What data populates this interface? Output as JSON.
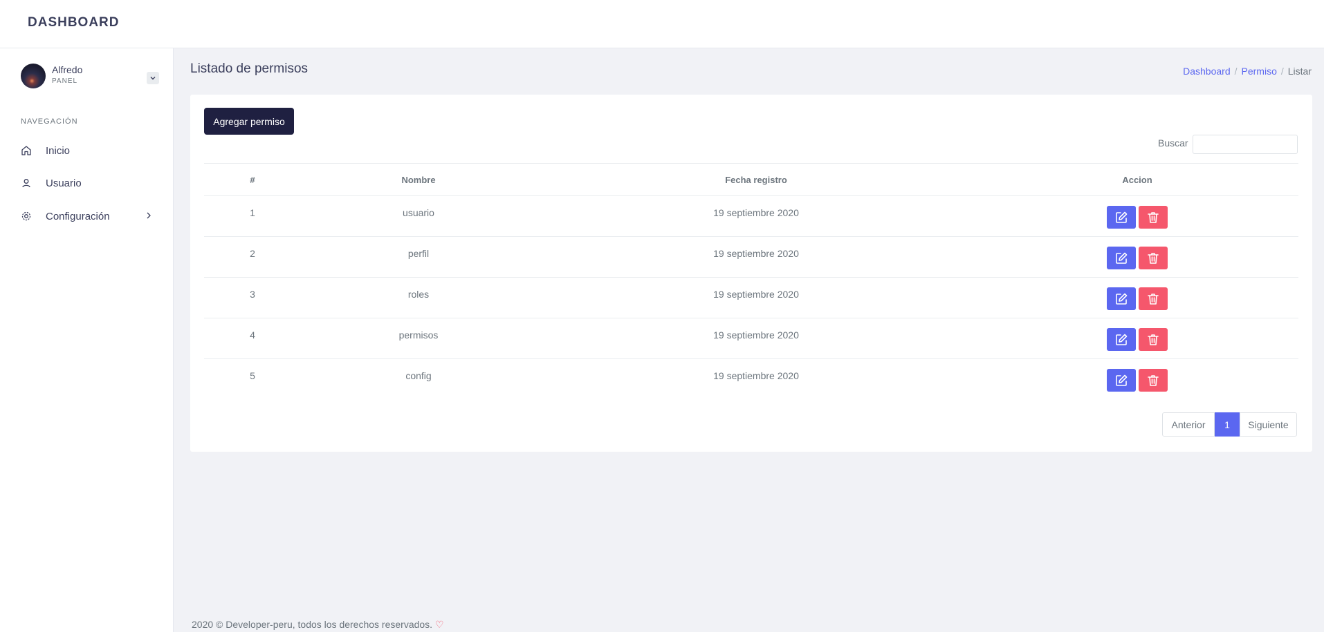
{
  "brand": "DASHBOARD",
  "user": {
    "name": "Alfredo",
    "role": "PANEL"
  },
  "nav": {
    "heading": "NAVEGACIÓN",
    "items": [
      {
        "label": "Inicio",
        "icon": "home-icon"
      },
      {
        "label": "Usuario",
        "icon": "user-icon"
      },
      {
        "label": "Configuración",
        "icon": "gear-icon"
      }
    ]
  },
  "page": {
    "title": "Listado de permisos"
  },
  "breadcrumb": {
    "items": [
      "Dashboard",
      "Permiso"
    ],
    "current": "Listar"
  },
  "actions": {
    "add_label": "Agregar permiso"
  },
  "search": {
    "label": "Buscar",
    "value": ""
  },
  "table": {
    "headers": [
      "#",
      "Nombre",
      "Fecha registro",
      "Accion"
    ],
    "rows": [
      {
        "id": "1",
        "name": "usuario",
        "date": "19 septiembre 2020"
      },
      {
        "id": "2",
        "name": "perfil",
        "date": "19 septiembre 2020"
      },
      {
        "id": "3",
        "name": "roles",
        "date": "19 septiembre 2020"
      },
      {
        "id": "4",
        "name": "permisos",
        "date": "19 septiembre 2020"
      },
      {
        "id": "5",
        "name": "config",
        "date": "19 septiembre 2020"
      }
    ]
  },
  "pagination": {
    "prev": "Anterior",
    "current": "1",
    "next": "Siguiente"
  },
  "footer": {
    "text": "2020 © Developer-peru, todos los derechos reservados.",
    "icon": "heart-icon"
  },
  "colors": {
    "primary": "#5b67f0",
    "danger": "#f5576c",
    "dark": "#1f2041"
  }
}
